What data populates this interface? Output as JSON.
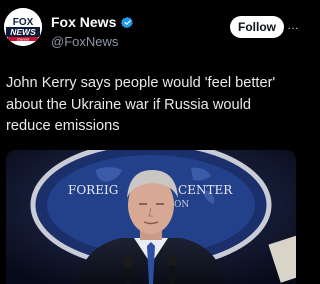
{
  "account": {
    "name": "Fox News",
    "handle": "@FoxNews",
    "avatar_text": {
      "line1": "FOX",
      "line2": "NEWS",
      "line3": "channel"
    }
  },
  "actions": {
    "follow_label": "Follow",
    "more_label": "…"
  },
  "tweet": {
    "text": "John Kerry says people would 'feel better' about the Ukraine war if Russia would reduce emissions"
  },
  "media": {
    "backdrop_text": "FOREIGN PRESS CENTER",
    "backdrop_left": "FOREIG",
    "backdrop_right": "CENTER",
    "backdrop_sub": "ON"
  },
  "colors": {
    "verified": "#1d9bf0",
    "background": "#000000",
    "follow_bg": "#ffffff",
    "handle": "#8b98a5"
  }
}
